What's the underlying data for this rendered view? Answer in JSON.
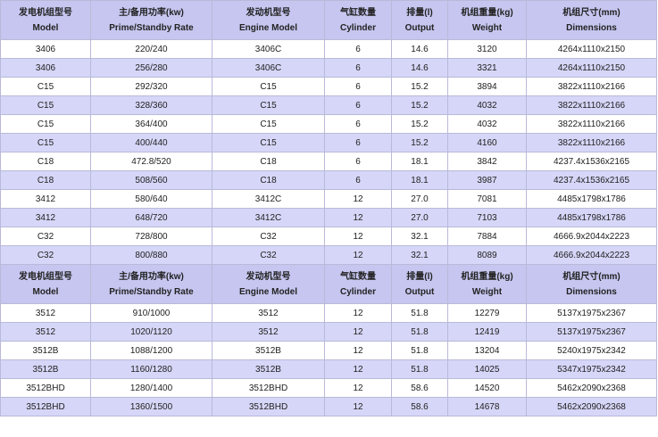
{
  "headers": [
    {
      "zh": "发电机组型号",
      "en": "Model"
    },
    {
      "zh": "主/备用功率(kw)",
      "en": "Prime/Standby Rate"
    },
    {
      "zh": "发动机型号",
      "en": "Engine Model"
    },
    {
      "zh": "气缸数量",
      "en": "Cylinder"
    },
    {
      "zh": "排量(l)",
      "en": "Output"
    },
    {
      "zh": "机组重量(kg)",
      "en": "Weight"
    },
    {
      "zh": "机组尺寸(mm)",
      "en": "Dimensions"
    }
  ],
  "rows_a": [
    [
      "3406",
      "220/240",
      "3406C",
      "6",
      "14.6",
      "3120",
      "4264x1110x2150"
    ],
    [
      "3406",
      "256/280",
      "3406C",
      "6",
      "14.6",
      "3321",
      "4264x1110x2150"
    ],
    [
      "C15",
      "292/320",
      "C15",
      "6",
      "15.2",
      "3894",
      "3822x1110x2166"
    ],
    [
      "C15",
      "328/360",
      "C15",
      "6",
      "15.2",
      "4032",
      "3822x1110x2166"
    ],
    [
      "C15",
      "364/400",
      "C15",
      "6",
      "15.2",
      "4032",
      "3822x1110x2166"
    ],
    [
      "C15",
      "400/440",
      "C15",
      "6",
      "15.2",
      "4160",
      "3822x1110x2166"
    ],
    [
      "C18",
      "472.8/520",
      "C18",
      "6",
      "18.1",
      "3842",
      "4237.4x1536x2165"
    ],
    [
      "C18",
      "508/560",
      "C18",
      "6",
      "18.1",
      "3987",
      "4237.4x1536x2165"
    ],
    [
      "3412",
      "580/640",
      "3412C",
      "12",
      "27.0",
      "7081",
      "4485x1798x1786"
    ],
    [
      "3412",
      "648/720",
      "3412C",
      "12",
      "27.0",
      "7103",
      "4485x1798x1786"
    ],
    [
      "C32",
      "728/800",
      "C32",
      "12",
      "32.1",
      "7884",
      "4666.9x2044x2223"
    ],
    [
      "C32",
      "800/880",
      "C32",
      "12",
      "32.1",
      "8089",
      "4666.9x2044x2223"
    ]
  ],
  "rows_b": [
    [
      "3512",
      "910/1000",
      "3512",
      "12",
      "51.8",
      "12279",
      "5137x1975x2367"
    ],
    [
      "3512",
      "1020/1120",
      "3512",
      "12",
      "51.8",
      "12419",
      "5137x1975x2367"
    ],
    [
      "3512B",
      "1088/1200",
      "3512B",
      "12",
      "51.8",
      "13204",
      "5240x1975x2342"
    ],
    [
      "3512B",
      "1160/1280",
      "3512B",
      "12",
      "51.8",
      "14025",
      "5347x1975x2342"
    ],
    [
      "3512BHD",
      "1280/1400",
      "3512BHD",
      "12",
      "58.6",
      "14520",
      "5462x2090x2368"
    ],
    [
      "3512BHD",
      "1360/1500",
      "3512BHD",
      "12",
      "58.6",
      "14678",
      "5462x2090x2368"
    ]
  ]
}
